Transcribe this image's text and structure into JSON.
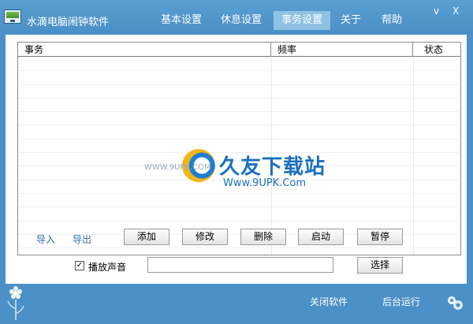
{
  "app": {
    "title": "水滴电脑闹钟软件"
  },
  "nav": {
    "tabs": [
      {
        "label": "基本设置"
      },
      {
        "label": "休息设置"
      },
      {
        "label": "事务设置"
      },
      {
        "label": "关于"
      },
      {
        "label": "帮助"
      }
    ],
    "active_index": 2
  },
  "window_controls": {
    "minimize": "v",
    "close": "X"
  },
  "table": {
    "columns": [
      "事务",
      "频率",
      "状态"
    ],
    "rows": []
  },
  "watermark": {
    "brand": "久友下载站",
    "url": "Www.9UPK.Com",
    "side": "WWW.9UPK.COM"
  },
  "actions": {
    "import": "导入",
    "export": "导出",
    "add": "添加",
    "edit": "修改",
    "delete": "删除",
    "start": "启动",
    "pause": "暂停"
  },
  "sound": {
    "checkbox_checked": true,
    "checkbox_mark": "✓",
    "label": "播放声音",
    "path_value": "",
    "choose": "选择"
  },
  "footer": {
    "close_app": "关闭软件",
    "run_background": "后台运行"
  },
  "colors": {
    "window_bg": "#4b90c6",
    "active_tab": "#8ec2e4",
    "link": "#2d6fb0"
  }
}
